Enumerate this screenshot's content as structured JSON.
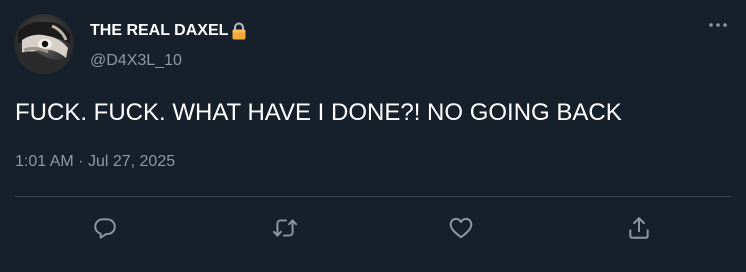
{
  "tweet": {
    "display_name": "THE REAL DAXEL",
    "handle": "@D4X3L_10",
    "text": "FUCK. FUCK. WHAT HAVE I DONE?! NO GOING BACK",
    "time": "1:01 AM",
    "separator": "·",
    "date": "Jul 27, 2025"
  },
  "icons": {
    "name_badge": "lock-icon",
    "more": "more-options-icon",
    "reply": "reply-icon",
    "retweet": "retweet-icon",
    "like": "heart-icon",
    "share": "share-icon"
  },
  "colors": {
    "background": "#15202b",
    "primary_text": "#ffffff",
    "secondary_text": "#8b98a5",
    "divider": "#38444d",
    "lock": "#f4a93b"
  }
}
